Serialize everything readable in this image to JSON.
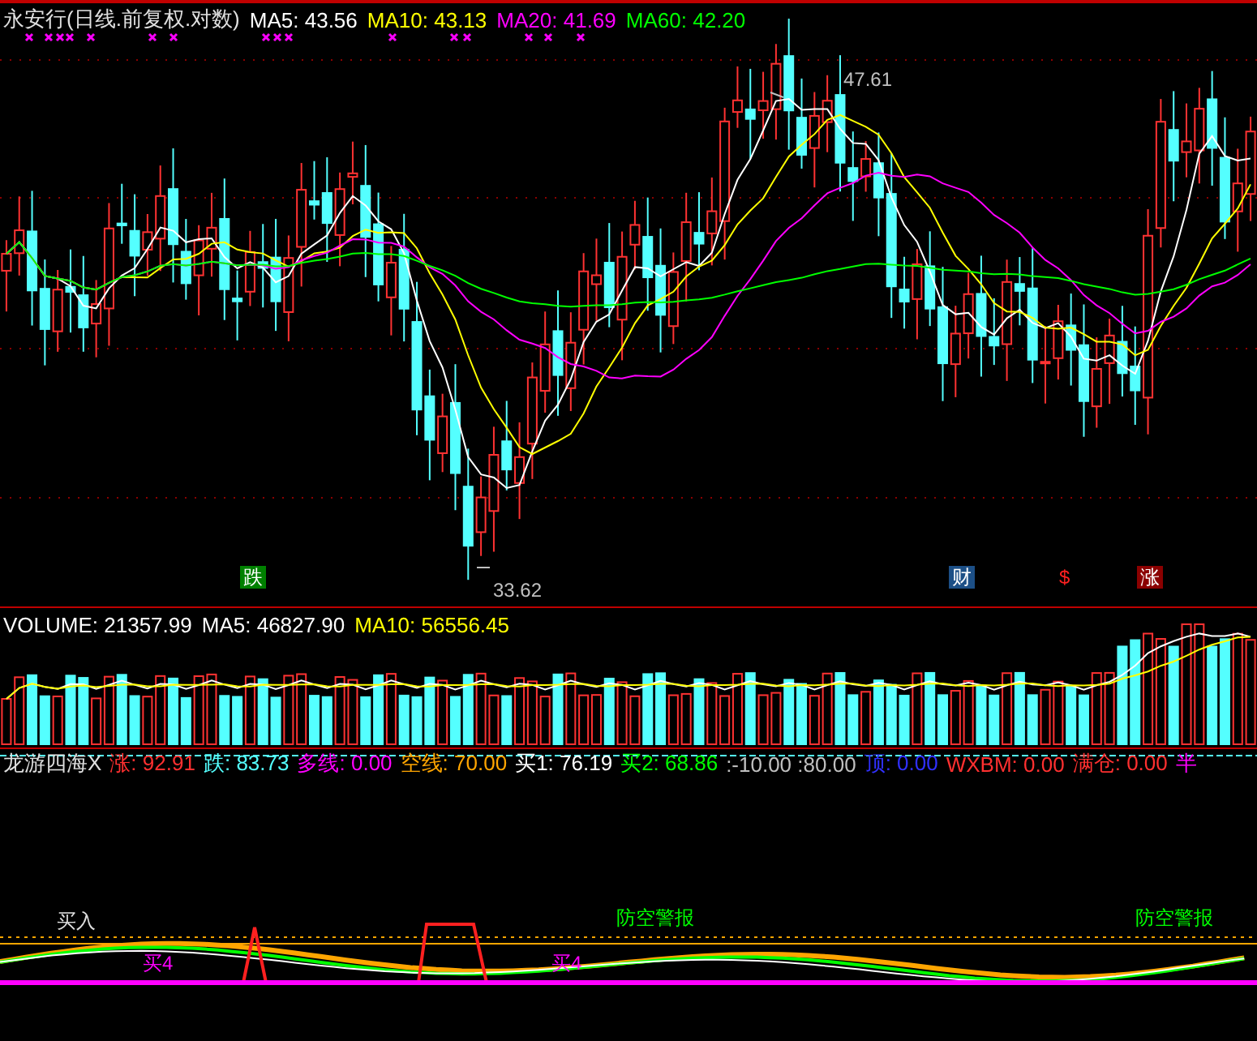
{
  "main_chart": {
    "title": "永安行(日线.前复权.对数)",
    "moving_averages": [
      {
        "label": "MA5:",
        "value": "43.56",
        "color": "#ffffff"
      },
      {
        "label": "MA10:",
        "value": "43.13",
        "color": "#ffff00"
      },
      {
        "label": "MA20:",
        "value": "41.69",
        "color": "#ff00ff"
      },
      {
        "label": "MA60:",
        "value": "42.20",
        "color": "#00ff00"
      }
    ],
    "high_label": "47.61",
    "low_label": "33.62",
    "events": [
      {
        "text": "跌",
        "color": "#008000"
      },
      {
        "text": "财",
        "color": "#1c4f86"
      },
      {
        "text": "$",
        "color": "#000000"
      },
      {
        "text": "涨",
        "color": "#8b0000"
      }
    ]
  },
  "volume": {
    "items": [
      {
        "label": "VOLUME:",
        "value": "21357.99",
        "color": "#ffffff"
      },
      {
        "label": "MA5:",
        "value": "46827.90",
        "color": "#ffffff"
      },
      {
        "label": "MA10:",
        "value": "56556.45",
        "color": "#ffff00"
      }
    ]
  },
  "indicator": {
    "name": "龙游四海X",
    "items": [
      {
        "label": "涨:",
        "value": "92.91",
        "color": "#ff3030"
      },
      {
        "label": "跌:",
        "value": "83.73",
        "color": "#54ffff"
      },
      {
        "label": "多线:",
        "value": "0.00",
        "color": "#ff00ff"
      },
      {
        "label": "空线:",
        "value": "70.00",
        "color": "#ffa500"
      },
      {
        "label": "买1:",
        "value": "76.19",
        "color": "#ffffff"
      },
      {
        "label": "买2:",
        "value": "68.86",
        "color": "#00ff00"
      },
      {
        "label": ":-10.00",
        "value": ":80.00",
        "color": "#c0c0c0"
      },
      {
        "label": "顶:",
        "value": "0.00",
        "color": "#3030ff"
      },
      {
        "label": "WXBM:",
        "value": "0.00",
        "color": "#ff3030"
      },
      {
        "label": "满仓:",
        "value": "0.00",
        "color": "#ff3030"
      },
      {
        "label": "半",
        "value": "",
        "color": "#ff00ff"
      }
    ],
    "signals": [
      {
        "text": "买入",
        "color": "#e0e0e0"
      },
      {
        "text": "买4",
        "color": "#ff00ff"
      },
      {
        "text": "买4",
        "color": "#ff00ff"
      },
      {
        "text": "防空警报",
        "color": "#00ff00"
      },
      {
        "text": "防空警报",
        "color": "#00ff00"
      }
    ]
  }
}
